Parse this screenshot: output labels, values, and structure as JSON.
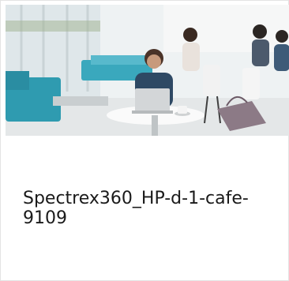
{
  "card": {
    "title": "Spectrex360_HP-d-1-cafe-9109"
  }
}
